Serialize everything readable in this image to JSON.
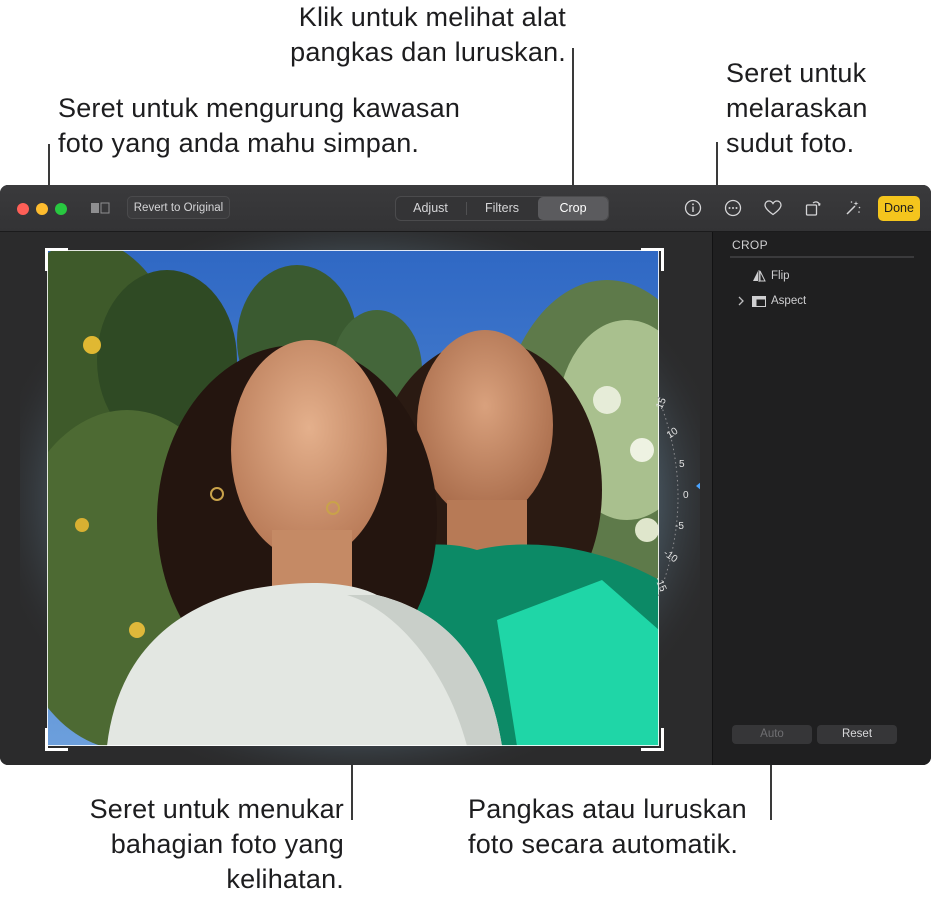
{
  "callouts": {
    "crop_tool": "Klik untuk melihat alat\npangkas dan luruskan.",
    "frame": "Seret untuk mengurung kawasan\nfoto yang anda mahu simpan.",
    "angle": "Seret untuk\nmelaraskan\nsudut foto.",
    "move": "Seret untuk menukar\nbahagian foto yang\nkelihatan.",
    "auto": "Pangkas atau luruskan\nfoto secara automatik."
  },
  "toolbar": {
    "revert_label": "Revert to Original",
    "tabs": [
      {
        "label": "Adjust",
        "active": false
      },
      {
        "label": "Filters",
        "active": false
      },
      {
        "label": "Crop",
        "active": true
      }
    ],
    "done_label": "Done",
    "icons": [
      "info-icon",
      "more-icon",
      "heart-icon",
      "rotate-icon",
      "magic-wand-icon"
    ]
  },
  "dial": {
    "labels": [
      "15",
      "10",
      "5",
      "0",
      "-5",
      "-10",
      "-15"
    ],
    "value": 0
  },
  "panel": {
    "title": "CROP",
    "flip_label": "Flip",
    "aspect_label": "Aspect",
    "auto_label": "Auto",
    "reset_label": "Reset"
  },
  "colors": {
    "accent": "#f4c51d",
    "dial_indicator": "#4aa3ff"
  }
}
